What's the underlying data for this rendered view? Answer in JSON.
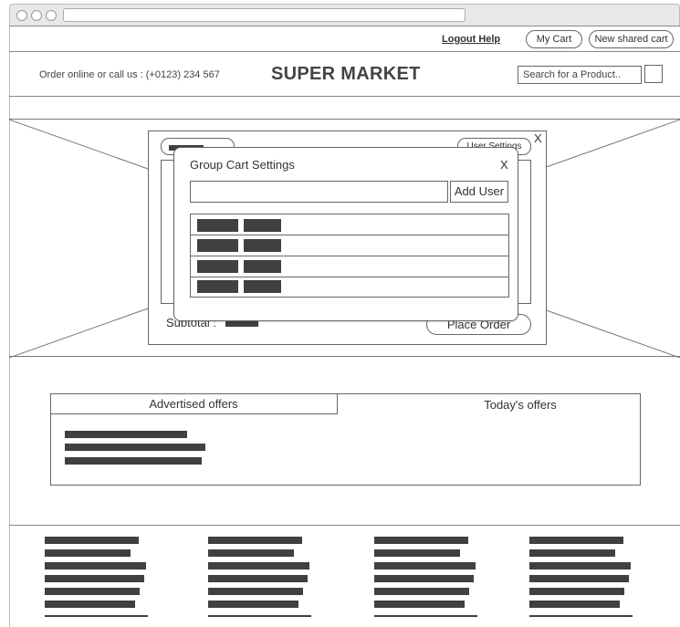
{
  "topnav": {
    "logout_help": "Logout Help",
    "my_cart": "My Cart",
    "new_shared_cart": "New shared cart"
  },
  "header": {
    "contact": "Order online or call us : (+0123) 234 567",
    "brand": "SUPER MARKET",
    "search_placeholder": "Search for a Product.."
  },
  "background_cart": {
    "user_settings": "User Settings",
    "subtotal": "Subtotal :",
    "place_order": "Place Order",
    "close": "X"
  },
  "dialog": {
    "title": "Group Cart Settings",
    "close": "X",
    "add_user": "Add User",
    "user_input_value": "",
    "rows": 4
  },
  "offers": {
    "tab_advertised": "Advertised offers",
    "tab_today": "Today's offers"
  }
}
